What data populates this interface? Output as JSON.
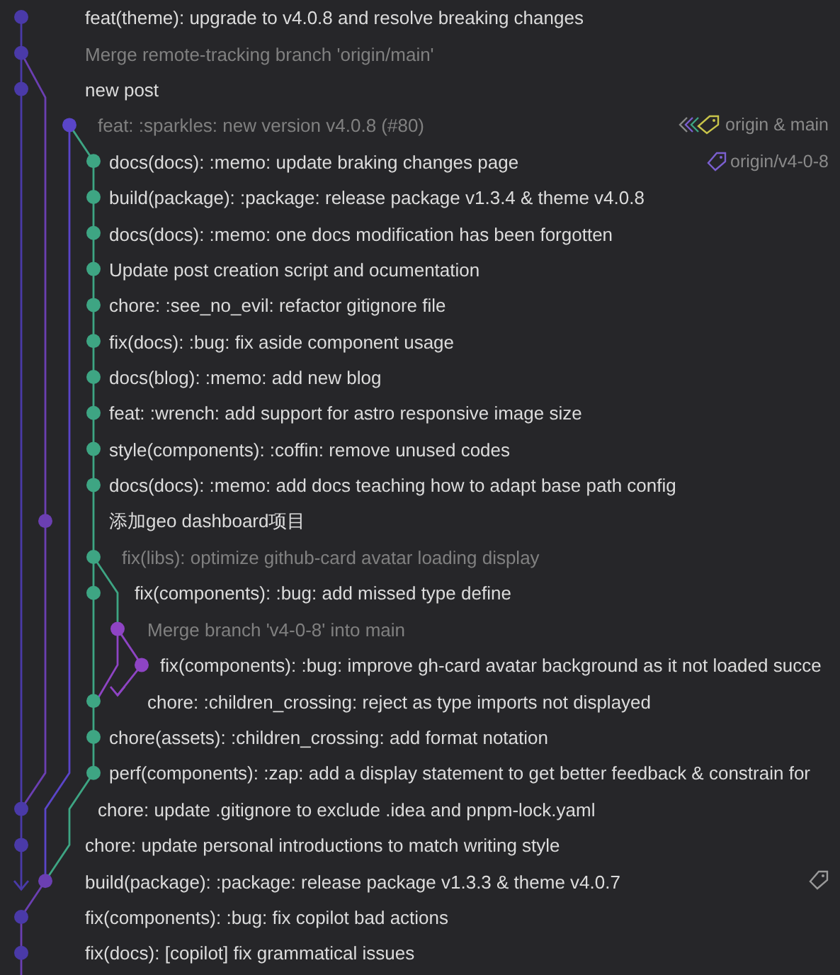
{
  "commits": [
    {
      "message": "feat(theme): upgrade to v4.0.8 and resolve breaking changes",
      "dimmed": false
    },
    {
      "message": "Merge remote-tracking branch 'origin/main'",
      "dimmed": true
    },
    {
      "message": "new post",
      "dimmed": false
    },
    {
      "message": "feat: :sparkles: new version v4.0.8 (#80)",
      "dimmed": true,
      "ref": {
        "kind": "stack",
        "label": "origin & main"
      }
    },
    {
      "message": "docs(docs): :memo: update braking changes page",
      "dimmed": false,
      "ref": {
        "kind": "tag",
        "label": "origin/v4-0-8"
      }
    },
    {
      "message": "build(package): :package: release package v1.3.4 & theme v4.0.8",
      "dimmed": false
    },
    {
      "message": "docs(docs): :memo: one docs modification has been forgotten",
      "dimmed": false
    },
    {
      "message": "Update post creation script and ocumentation",
      "dimmed": false
    },
    {
      "message": "chore: :see_no_evil: refactor gitignore file",
      "dimmed": false
    },
    {
      "message": "fix(docs): :bug: fix aside component usage",
      "dimmed": false
    },
    {
      "message": "docs(blog): :memo: add new blog",
      "dimmed": false
    },
    {
      "message": "feat: :wrench: add support for astro responsive image size",
      "dimmed": false
    },
    {
      "message": "style(components): :coffin: remove unused codes",
      "dimmed": false
    },
    {
      "message": "docs(docs): :memo: add docs teaching how to adapt base path config",
      "dimmed": false
    },
    {
      "message": "添加geo dashboard项目",
      "dimmed": false
    },
    {
      "message": "fix(libs): optimize github-card avatar loading display",
      "dimmed": true
    },
    {
      "message": "fix(components): :bug: add missed type define",
      "dimmed": false
    },
    {
      "message": "Merge branch 'v4-0-8' into main",
      "dimmed": true
    },
    {
      "message": "fix(components): :bug: improve gh-card avatar background as it not loaded succe",
      "dimmed": false
    },
    {
      "message": "chore: :children_crossing: reject as type imports not displayed",
      "dimmed": false
    },
    {
      "message": "chore(assets): :children_crossing: add format notation",
      "dimmed": false
    },
    {
      "message": "perf(components): :zap: add a display statement to get better feedback & constrain for",
      "dimmed": false
    },
    {
      "message": "chore: update .gitignore to exclude .idea and pnpm-lock.yaml",
      "dimmed": false
    },
    {
      "message": "chore: update personal introductions to match writing style",
      "dimmed": false
    },
    {
      "message": "build(package): :package: release package v1.3.3 & theme v4.0.7",
      "dimmed": false,
      "ref": {
        "kind": "tag"
      }
    },
    {
      "message": "fix(components): :bug: fix copilot bad actions",
      "dimmed": false
    },
    {
      "message": "fix(docs): [copilot] fix grammatical issues",
      "dimmed": false
    }
  ]
}
